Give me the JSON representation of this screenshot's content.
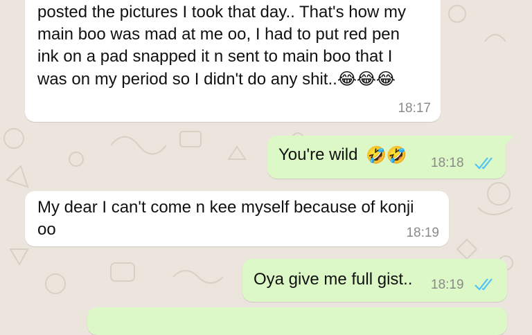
{
  "colors": {
    "background": "#ece5dd",
    "incoming_bubble": "#ffffff",
    "outgoing_bubble": "#dcf8c6",
    "read_ticks": "#4fc3f7"
  },
  "messages": [
    {
      "direction": "incoming",
      "text": "posted the pictures I took that day.. That's how my\nmain boo was mad at me oo, I had to put red pen\nink on a pad snapped it n sent to main boo that I\nwas on my period so I didn't do any shit..",
      "emoji": "😂😂😂",
      "time": "18:17"
    },
    {
      "direction": "outgoing",
      "text": "You're wild",
      "emoji": "🤣🤣",
      "time": "18:18",
      "status_icon": "double-check-icon"
    },
    {
      "direction": "incoming",
      "text": "My dear I can't come n kee myself because of konji\noo",
      "time": "18:19"
    },
    {
      "direction": "outgoing",
      "text": "Oya give me full gist..",
      "time": "18:19",
      "status_icon": "double-check-icon"
    }
  ]
}
